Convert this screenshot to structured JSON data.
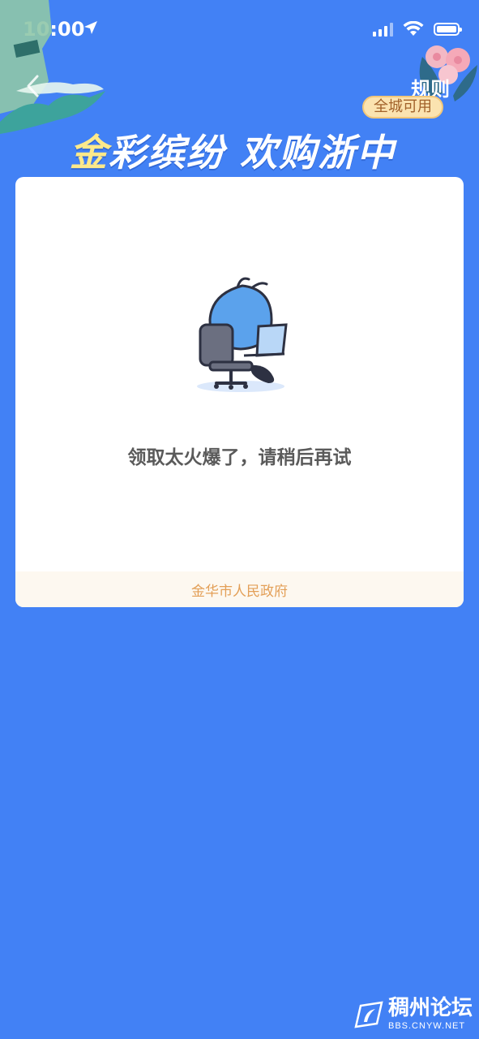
{
  "status_bar": {
    "time": "10:00"
  },
  "header": {
    "rules_label": "规则",
    "badge_label": "全城可用",
    "banner_title_gold": "金",
    "banner_title_rest": "彩缤纷 欢购浙中"
  },
  "card": {
    "message": "领取太火爆了，请稍后再试",
    "footer": "金华市人民政府"
  },
  "watermark": {
    "title": "稠州论坛",
    "url": "BBS.CNYW.NET"
  },
  "colors": {
    "background": "#4281f5",
    "card": "#ffffff",
    "footer_text": "#e39f57",
    "gold": "#fde98a"
  }
}
